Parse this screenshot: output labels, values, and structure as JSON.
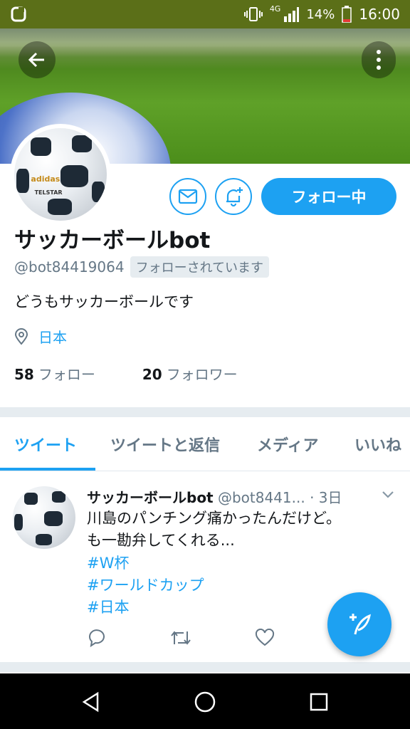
{
  "status_bar": {
    "network": "4G",
    "battery_percent": "14%",
    "time": "16:00"
  },
  "profile": {
    "name": "サッカーボールbot",
    "handle": "@bot84419064",
    "follows_you_badge": "フォローされています",
    "bio": "どうもサッカーボールです",
    "location": "日本",
    "following_count": "58",
    "following_label": "フォロー",
    "followers_count": "20",
    "followers_label": "フォロワー",
    "follow_button_label": "フォロー中"
  },
  "tabs": [
    {
      "label": "ツイート",
      "active": true
    },
    {
      "label": "ツイートと返信",
      "active": false
    },
    {
      "label": "メディア",
      "active": false
    },
    {
      "label": "いいね",
      "active": false
    }
  ],
  "tweet": {
    "author_name": "サッカーボールbot",
    "author_handle": "@bot8441...",
    "time": "· 3日",
    "line1": "川島のパンチング痛かったんだけど。",
    "line2": "も一勘弁してくれる...",
    "hashtags": [
      "#W杯",
      "#ワールドカップ",
      "#日本"
    ]
  },
  "ball_text": {
    "brand": "adidas",
    "model": "TELSTAR"
  },
  "colors": {
    "accent": "#1da1f2",
    "status_bar": "#5b6f18",
    "nav_bar": "#000000"
  },
  "icons": [
    "back-arrow-icon",
    "more-vertical-icon",
    "mail-icon",
    "bell-plus-icon",
    "location-pin-icon",
    "reply-icon",
    "retweet-icon",
    "like-icon",
    "compose-icon",
    "chevron-down-icon"
  ]
}
